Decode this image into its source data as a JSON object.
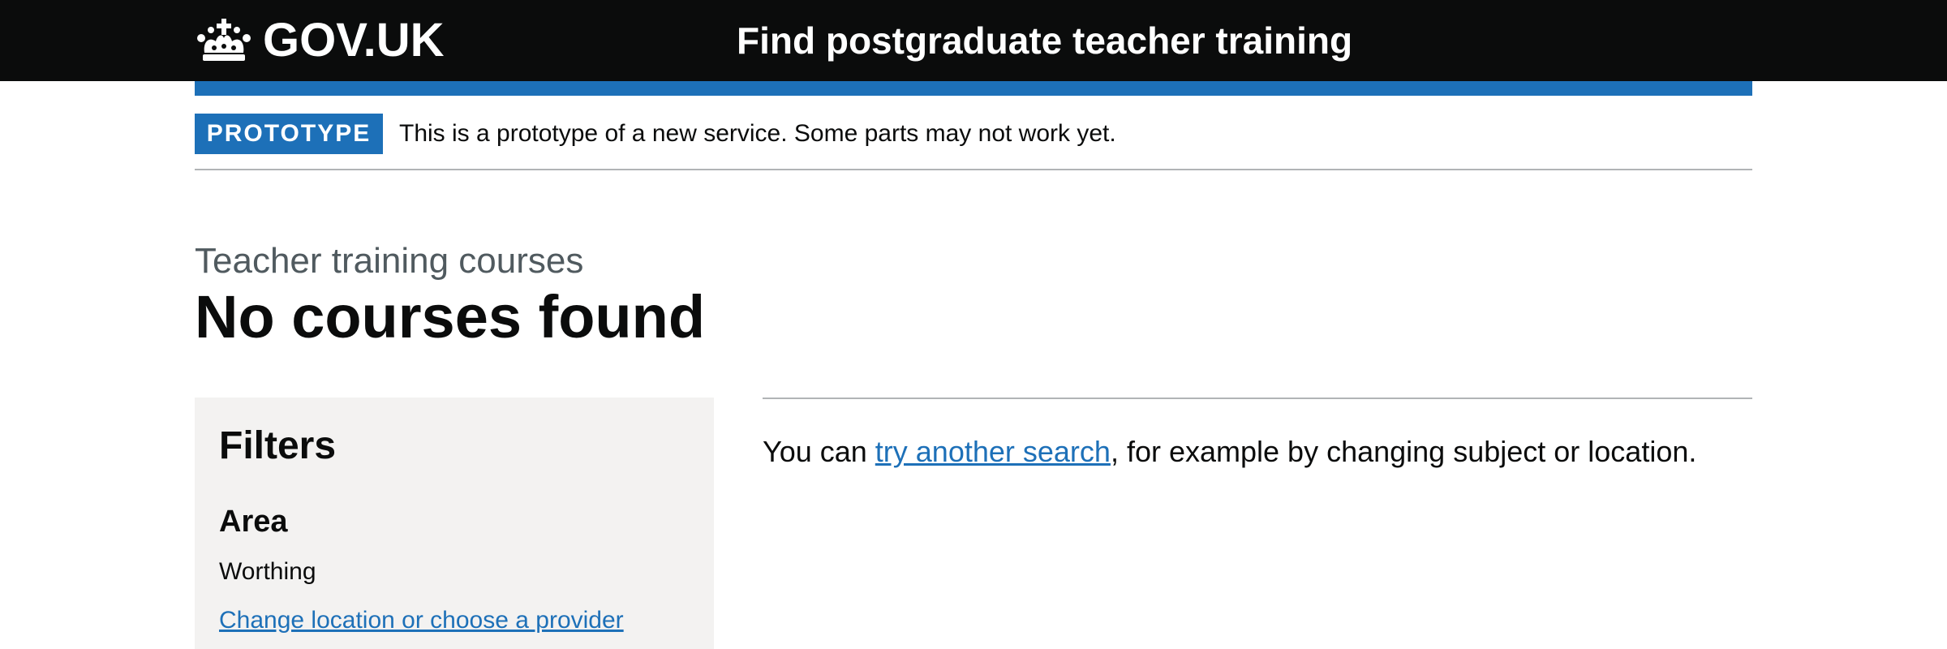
{
  "header": {
    "logo_text": "GOV.UK",
    "service_name": "Find postgraduate teacher training",
    "background_color": "#0b0c0c",
    "accent_color": "#1d70b8"
  },
  "phase_banner": {
    "tag": "PROTOTYPE",
    "text": "This is a prototype of a new service. Some parts may not work yet."
  },
  "page": {
    "caption": "Teacher training courses",
    "title": "No courses found"
  },
  "filters": {
    "heading": "Filters",
    "area_label": "Area",
    "area_value": "Worthing",
    "change_link": "Change location or choose a provider"
  },
  "results": {
    "text_before": "You can ",
    "link_text": "try another search",
    "text_after": ", for example by changing subject or location."
  },
  "icons": {
    "crown": "crown-icon"
  }
}
